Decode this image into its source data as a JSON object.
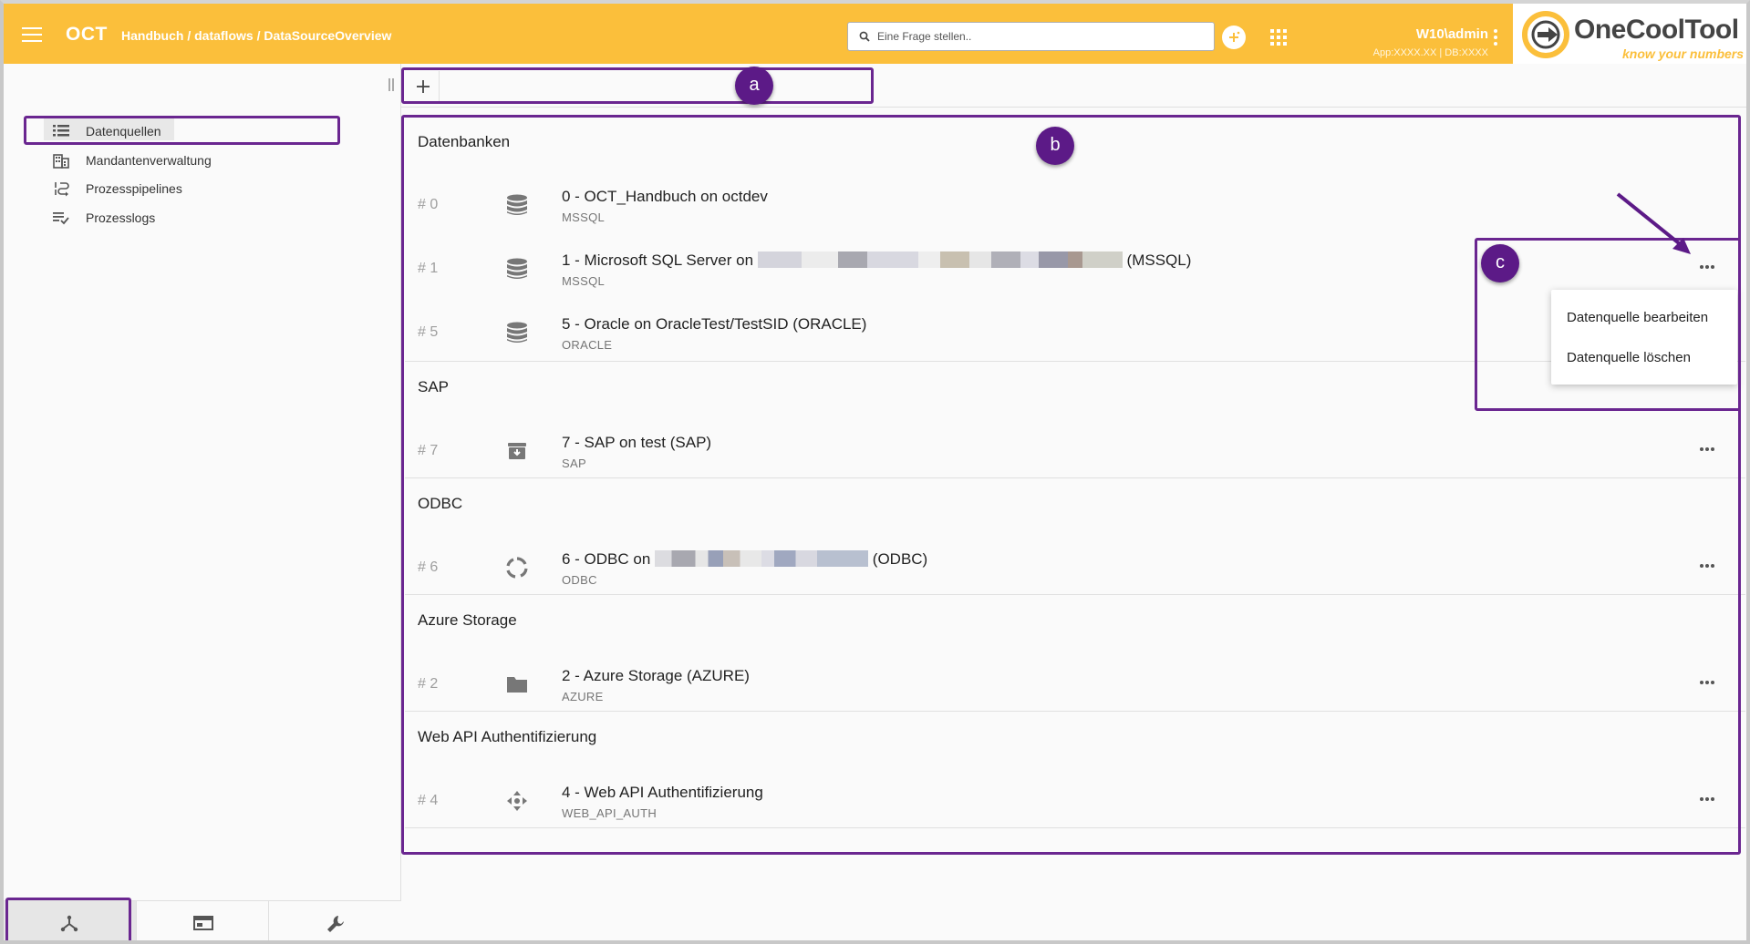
{
  "header": {
    "menu_icon": "hamburger-menu-icon",
    "app_name": "OCT",
    "breadcrumb": "Handbuch / dataflows / DataSourceOverview",
    "search_placeholder": "Eine Frage stellen..",
    "user_name": "W10\\admin",
    "user_sub": "App:XXXX.XX | DB:XXXX",
    "logo_text": "OneCoolTool",
    "logo_tagline": "know your numbers",
    "accent_color": "#fbbf3b"
  },
  "sidebar": {
    "items": [
      {
        "label": "Datenquellen",
        "icon": "list-icon",
        "active": true
      },
      {
        "label": "Mandantenverwaltung",
        "icon": "building-icon",
        "active": false
      },
      {
        "label": "Prozesspipelines",
        "icon": "pipeline-icon",
        "active": false
      },
      {
        "label": "Prozesslogs",
        "icon": "log-list-icon",
        "active": false
      }
    ],
    "bottom_tabs": [
      {
        "icon": "dataflow-icon",
        "active": true
      },
      {
        "icon": "window-icon",
        "active": false
      },
      {
        "icon": "wrench-icon",
        "active": false
      }
    ]
  },
  "toolbar": {
    "add_icon": "plus-icon"
  },
  "groups": [
    {
      "title": "Datenbanken",
      "rows": [
        {
          "num": "# 0",
          "icon": "database-icon",
          "name": "0 - OCT_Handbuch on octdev",
          "name_suffix": "",
          "type": "MSSQL"
        },
        {
          "num": "# 1",
          "icon": "database-icon",
          "name": "1 - Microsoft SQL Server on",
          "name_suffix": "(MSSQL)",
          "type": "MSSQL"
        },
        {
          "num": "# 5",
          "icon": "database-icon",
          "name": "5 - Oracle on OracleTest/TestSID (ORACLE)",
          "name_suffix": "",
          "type": "ORACLE"
        }
      ]
    },
    {
      "title": "SAP",
      "rows": [
        {
          "num": "# 7",
          "icon": "archive-icon",
          "name": "7 - SAP on test (SAP)",
          "name_suffix": "",
          "type": "SAP"
        }
      ]
    },
    {
      "title": "ODBC",
      "rows": [
        {
          "num": "# 6",
          "icon": "loading-circle-icon",
          "name": "6 - ODBC on",
          "name_suffix": "(ODBC)",
          "type": "ODBC"
        }
      ]
    },
    {
      "title": "Azure Storage",
      "rows": [
        {
          "num": "# 2",
          "icon": "folder-icon",
          "name": "2 - Azure Storage (AZURE)",
          "name_suffix": "",
          "type": "AZURE"
        }
      ]
    },
    {
      "title": "Web API Authentifizierung",
      "rows": [
        {
          "num": "# 4",
          "icon": "move-arrows-icon",
          "name": "4 - Web API Authentifizierung",
          "name_suffix": "",
          "type": "WEB_API_AUTH"
        }
      ]
    }
  ],
  "context_menu": {
    "items": [
      "Datenquelle bearbeiten",
      "Datenquelle löschen"
    ]
  },
  "annotations": {
    "labels": [
      "a",
      "b",
      "c"
    ],
    "color": "#6a2690"
  }
}
